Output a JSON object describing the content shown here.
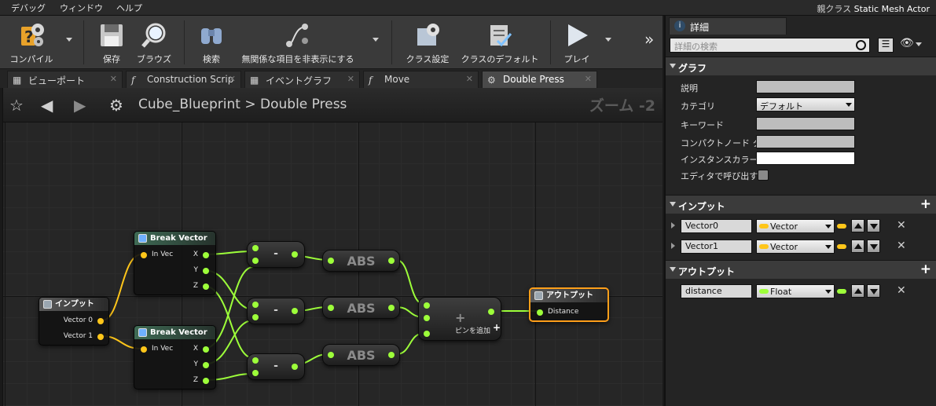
{
  "menu": {
    "items": [
      "デバッグ",
      "ウィンドウ",
      "ヘルプ"
    ],
    "parent_class_label": "親クラス",
    "parent_class_value": "Static Mesh Actor"
  },
  "toolbar": {
    "compile": "コンパイル",
    "save": "保存",
    "browse": "ブラウズ",
    "find": "検索",
    "hide_unrelated": "無関係な項目を非表示にする",
    "class_settings": "クラス設定",
    "class_defaults": "クラスのデフォルト",
    "play": "プレイ",
    "overflow": "»"
  },
  "tabs": [
    {
      "label": "ビューポート",
      "icon": "grid-icon"
    },
    {
      "label": "Construction Scrip",
      "icon": "function-icon"
    },
    {
      "label": "イベントグラフ",
      "icon": "grid-icon"
    },
    {
      "label": "Move",
      "icon": "function-icon"
    },
    {
      "label": "Double Press",
      "icon": "gear-icon"
    }
  ],
  "graph": {
    "breadcrumb_root": "Cube_Blueprint",
    "breadcrumb_sep": ">",
    "breadcrumb_leaf": "Double Press",
    "zoom": "ズーム -2",
    "nodes": {
      "input": {
        "title": "インプット",
        "pins": [
          "Vector 0",
          "Vector 1"
        ]
      },
      "break1": {
        "title": "Break Vector",
        "in_pin": "In Vec",
        "out_pins": [
          "X",
          "Y",
          "Z"
        ]
      },
      "break2": {
        "title": "Break Vector",
        "in_pin": "In Vec",
        "out_pins": [
          "X",
          "Y",
          "Z"
        ]
      },
      "minus": "-",
      "abs": "ABS",
      "add": {
        "symbol": "+",
        "add_pin": "ピンを追加"
      },
      "output": {
        "title": "アウトプット",
        "pin": "Distance"
      }
    }
  },
  "details": {
    "tab_label": "詳細",
    "search_placeholder": "詳細の検索",
    "graph_section": "グラフ",
    "props": {
      "description": "説明",
      "category": "カテゴリ",
      "category_value": "デフォルト",
      "keywords": "キーワード",
      "compact_title": "コンパクトノード タ",
      "instance_color": "インスタンスカラー",
      "call_in_editor": "エディタで呼び出す"
    },
    "inputs_section": "インプット",
    "inputs": [
      {
        "name": "Vector0",
        "type": "Vector"
      },
      {
        "name": "Vector1",
        "type": "Vector"
      }
    ],
    "outputs_section": "アウトプット",
    "outputs": [
      {
        "name": "distance",
        "type": "Float"
      }
    ]
  },
  "colors": {
    "vector_pin": "#ffc61a",
    "float_pin": "#9dff3a",
    "output_highlight": "#ff9f1a"
  }
}
